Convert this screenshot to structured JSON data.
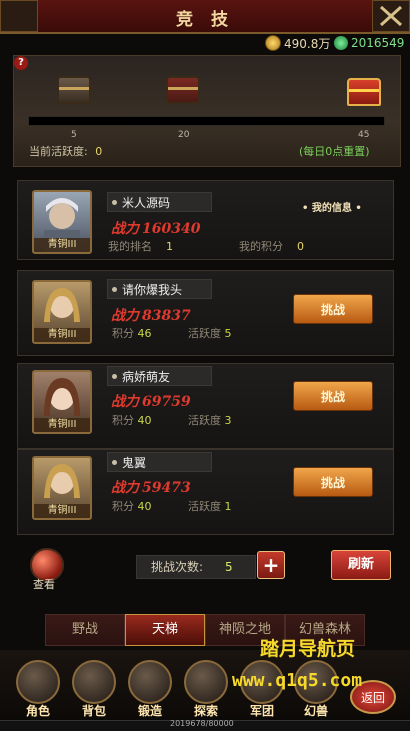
{
  "header": {
    "title": "竞 技"
  },
  "currency": {
    "gold": "490.8万",
    "gems": "2016549"
  },
  "activity": {
    "milestones": [
      "5",
      "20",
      "45"
    ],
    "current_label": "当前活跃度:",
    "current_value": "0",
    "reset_note": "(每日0点重置)"
  },
  "me": {
    "name": "米人源码",
    "power_label": "战力",
    "power": "160340",
    "rank_label": "我的排名",
    "rank": "1",
    "score_label": "我的积分",
    "score": "0",
    "info_label": "我的信息",
    "badge": "青铜III"
  },
  "opponents": [
    {
      "name": "请你爆我头",
      "power_label": "战力",
      "power": "83837",
      "score_label": "积分",
      "score": "46",
      "activity_label": "活跃度",
      "activity": "5",
      "button": "挑战",
      "badge": "青铜III"
    },
    {
      "name": "病娇萌友",
      "power_label": "战力",
      "power": "69759",
      "score_label": "积分",
      "score": "40",
      "activity_label": "活跃度",
      "activity": "3",
      "button": "挑战",
      "badge": "青铜III"
    },
    {
      "name": "鬼翼",
      "power_label": "战力",
      "power": "59473",
      "score_label": "积分",
      "score": "40",
      "activity_label": "活跃度",
      "activity": "1",
      "button": "挑战",
      "badge": "青铜III"
    }
  ],
  "controls": {
    "view_label": "查看",
    "count_label": "挑战次数:",
    "count_value": "5",
    "plus": "+",
    "refresh": "刷新"
  },
  "tabs": [
    "野战",
    "天梯",
    "神陨之地",
    "幻兽森林"
  ],
  "active_tab": "天梯",
  "nav": [
    "角色",
    "背包",
    "锻造",
    "探索",
    "军团",
    "幻兽"
  ],
  "back": "返回",
  "exp_text": "2019678/80000",
  "watermark": {
    "line1": "踏月导航页",
    "line2": "www.q1q5.com"
  }
}
